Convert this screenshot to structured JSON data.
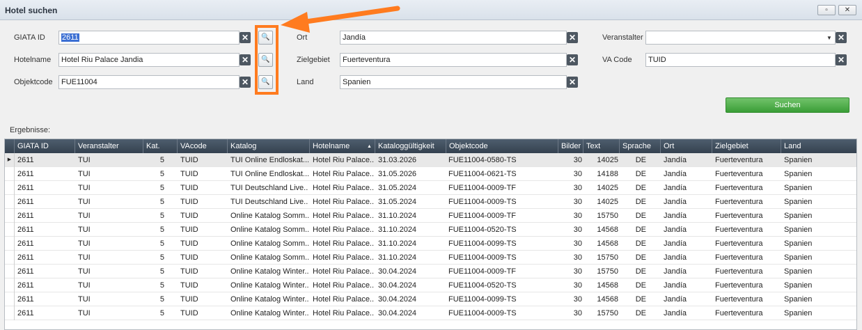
{
  "window": {
    "title": "Hotel suchen",
    "restore_glyph": "▫",
    "close_glyph": "✕"
  },
  "filters": {
    "giata_id": {
      "label": "GIATA ID",
      "value": "2611"
    },
    "hotelname": {
      "label": "Hotelname",
      "value": "Hotel Riu Palace Jandia"
    },
    "objektcode": {
      "label": "Objektcode",
      "value": "FUE11004"
    },
    "ort": {
      "label": "Ort",
      "value": "Jandía"
    },
    "zielgebiet": {
      "label": "Zielgebiet",
      "value": "Fuerteventura"
    },
    "land": {
      "label": "Land",
      "value": "Spanien"
    },
    "veranstalter": {
      "label": "Veranstalter",
      "value": ""
    },
    "va_code": {
      "label": "VA Code",
      "value": "TUID"
    },
    "clear_glyph": "✕",
    "search_glyph": "🔍"
  },
  "search_button": {
    "label": "Suchen",
    "color": "#4caf50"
  },
  "annotation": {
    "highlight_color": "#ff7b1f",
    "icon": "arrow-icon"
  },
  "results": {
    "label": "Ergebnisse:",
    "columns": [
      "GIATA ID",
      "Veranstalter",
      "Kat.",
      "VAcode",
      "Katalog",
      "Hotelname",
      "Kataloggültigkeit",
      "Objektcode",
      "Bilder",
      "Text",
      "Sprache",
      "Ort",
      "Zielgebiet",
      "Land"
    ],
    "rows": [
      [
        "2611",
        "TUI",
        "5",
        "TUID",
        "TUI Online Endloskat...",
        "Hotel Riu Palace...",
        "31.03.2026",
        "FUE11004-0580-TS",
        "30",
        "14025",
        "DE",
        "Jandía",
        "Fuerteventura",
        "Spanien"
      ],
      [
        "2611",
        "TUI",
        "5",
        "TUID",
        "TUI Online Endloskat...",
        "Hotel Riu Palace...",
        "31.05.2026",
        "FUE11004-0621-TS",
        "30",
        "14188",
        "DE",
        "Jandía",
        "Fuerteventura",
        "Spanien"
      ],
      [
        "2611",
        "TUI",
        "5",
        "TUID",
        "TUI Deutschland Live...",
        "Hotel Riu Palace...",
        "31.05.2024",
        "FUE11004-0009-TF",
        "30",
        "14025",
        "DE",
        "Jandía",
        "Fuerteventura",
        "Spanien"
      ],
      [
        "2611",
        "TUI",
        "5",
        "TUID",
        "TUI Deutschland Live...",
        "Hotel Riu Palace...",
        "31.05.2024",
        "FUE11004-0009-TS",
        "30",
        "14025",
        "DE",
        "Jandía",
        "Fuerteventura",
        "Spanien"
      ],
      [
        "2611",
        "TUI",
        "5",
        "TUID",
        "Online Katalog Somm...",
        "Hotel Riu Palace...",
        "31.10.2024",
        "FUE11004-0009-TF",
        "30",
        "15750",
        "DE",
        "Jandía",
        "Fuerteventura",
        "Spanien"
      ],
      [
        "2611",
        "TUI",
        "5",
        "TUID",
        "Online Katalog Somm...",
        "Hotel Riu Palace...",
        "31.10.2024",
        "FUE11004-0520-TS",
        "30",
        "14568",
        "DE",
        "Jandía",
        "Fuerteventura",
        "Spanien"
      ],
      [
        "2611",
        "TUI",
        "5",
        "TUID",
        "Online Katalog Somm...",
        "Hotel Riu Palace...",
        "31.10.2024",
        "FUE11004-0099-TS",
        "30",
        "14568",
        "DE",
        "Jandía",
        "Fuerteventura",
        "Spanien"
      ],
      [
        "2611",
        "TUI",
        "5",
        "TUID",
        "Online Katalog Somm...",
        "Hotel Riu Palace...",
        "31.10.2024",
        "FUE11004-0009-TS",
        "30",
        "15750",
        "DE",
        "Jandía",
        "Fuerteventura",
        "Spanien"
      ],
      [
        "2611",
        "TUI",
        "5",
        "TUID",
        "Online Katalog Winter...",
        "Hotel Riu Palace...",
        "30.04.2024",
        "FUE11004-0009-TF",
        "30",
        "15750",
        "DE",
        "Jandía",
        "Fuerteventura",
        "Spanien"
      ],
      [
        "2611",
        "TUI",
        "5",
        "TUID",
        "Online Katalog Winter...",
        "Hotel Riu Palace...",
        "30.04.2024",
        "FUE11004-0520-TS",
        "30",
        "14568",
        "DE",
        "Jandía",
        "Fuerteventura",
        "Spanien"
      ],
      [
        "2611",
        "TUI",
        "5",
        "TUID",
        "Online Katalog Winter...",
        "Hotel Riu Palace...",
        "30.04.2024",
        "FUE11004-0099-TS",
        "30",
        "14568",
        "DE",
        "Jandía",
        "Fuerteventura",
        "Spanien"
      ],
      [
        "2611",
        "TUI",
        "5",
        "TUID",
        "Online Katalog Winter...",
        "Hotel Riu Palace...",
        "30.04.2024",
        "FUE11004-0009-TS",
        "30",
        "15750",
        "DE",
        "Jandía",
        "Fuerteventura",
        "Spanien"
      ]
    ],
    "current_row_glyph": "▶"
  }
}
